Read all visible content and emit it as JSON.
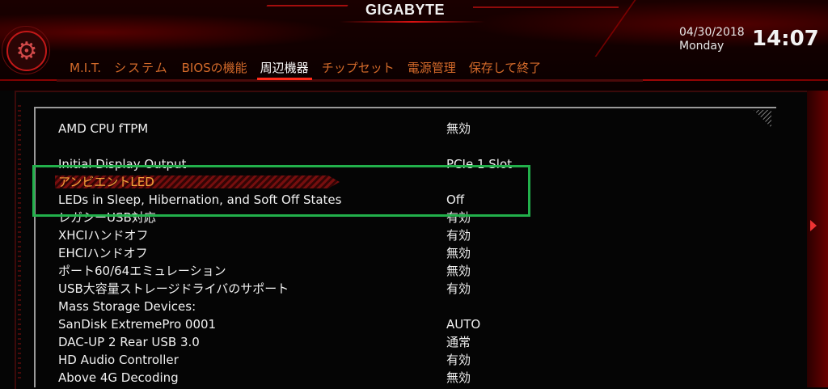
{
  "brand": "GIGABYTE",
  "datetime": {
    "date": "04/30/2018",
    "day": "Monday",
    "time": "14:07"
  },
  "tabs": [
    {
      "label": "M.I.T."
    },
    {
      "label": "システム"
    },
    {
      "label": "BIOSの機能"
    },
    {
      "label": "周辺機器",
      "active": true
    },
    {
      "label": "チップセット"
    },
    {
      "label": "電源管理"
    },
    {
      "label": "保存して終了"
    }
  ],
  "settings": [
    {
      "label": "AMD CPU fTPM",
      "value": "無効"
    },
    {
      "label": "Initial Display Output",
      "value": "PCIe 1 Slot"
    },
    {
      "label": "アンビエントLED",
      "value": "",
      "selected": true
    },
    {
      "label": "LEDs in Sleep, Hibernation, and Soft Off States",
      "value": "Off"
    },
    {
      "label": "レガシーUSB対応",
      "value": "有効"
    },
    {
      "label": "XHCIハンドオフ",
      "value": "有効"
    },
    {
      "label": "EHCIハンドオフ",
      "value": "無効"
    },
    {
      "label": "ポート60/64エミュレーション",
      "value": "無効"
    },
    {
      "label": "USB大容量ストレージドライバのサポート",
      "value": "有効"
    },
    {
      "label": "Mass Storage Devices:",
      "value": ""
    },
    {
      "label": "SanDisk ExtremePro 0001",
      "value": "AUTO"
    },
    {
      "label": "DAC-UP 2 Rear USB 3.0",
      "value": "通常"
    },
    {
      "label": "HD Audio Controller",
      "value": "有効"
    },
    {
      "label": "Above 4G Decoding",
      "value": "無効"
    }
  ],
  "colors": {
    "accent_red": "#ff2a1a",
    "selected_text": "#f2a33a",
    "highlight_box": "#22b04b"
  },
  "icons": {
    "settings": "gear-icon",
    "scroll": "arrow-right-icon"
  }
}
